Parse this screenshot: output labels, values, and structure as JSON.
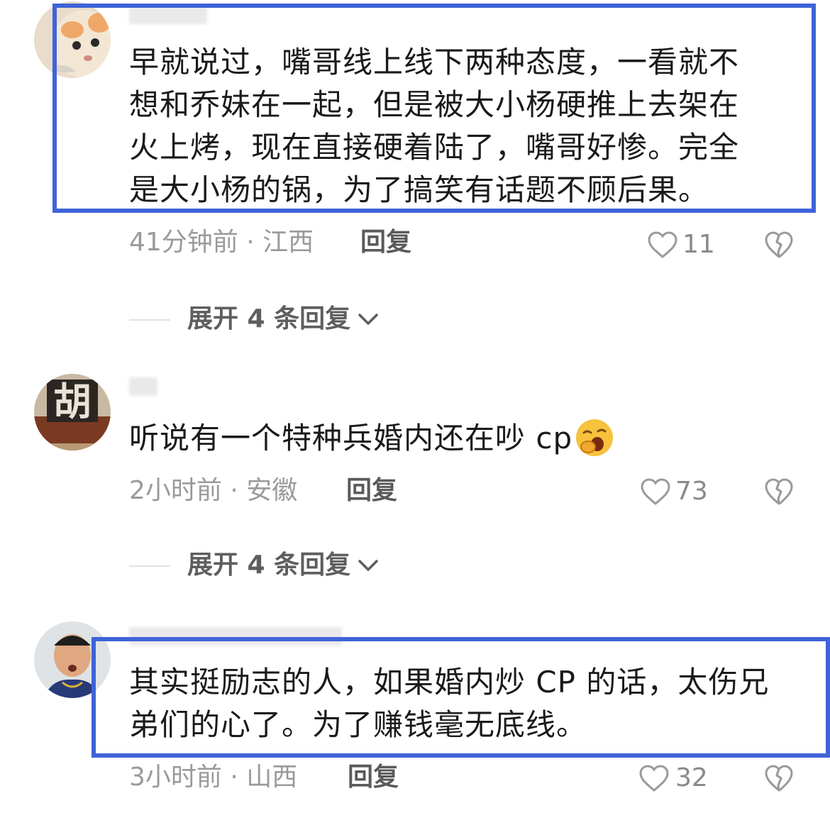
{
  "comments": [
    {
      "avatar": "cat-avatar",
      "lines": [
        "早就说过，嘴哥线上线下两种态度，一看就不",
        "想和乔妹在一起，但是被大小杨硬推上去架在",
        "火上烤，现在直接硬着陆了，嘴哥好惨。完全",
        "是大小杨的锅，为了搞笑有话题不顾后果。"
      ],
      "meta": "41分钟前 · 江西",
      "reply_label": "回复",
      "likes": "11",
      "expand_label": "展开 4 条回复"
    },
    {
      "avatar": "poster-avatar",
      "lines": [
        "听说有一个特种兵婚内还在吵 cp"
      ],
      "emoji": "yawning-face-emoji",
      "meta": "2小时前 · 安徽",
      "reply_label": "回复",
      "likes": "73",
      "expand_label": "展开 4 条回复"
    },
    {
      "avatar": "man-avatar",
      "lines": [
        "其实挺励志的人，如果婚内炒 CP 的话，太伤兄",
        "弟们的心了。为了赚钱毫无底线。"
      ],
      "meta": "3小时前 · 山西",
      "reply_label": "回复",
      "likes": "32"
    }
  ],
  "colors": {
    "highlight": "#3f63d8",
    "text": "#1a1a1a",
    "meta": "#9a9a9a"
  },
  "icons": [
    "heart-outline-icon",
    "broken-heart-icon",
    "chevron-down-icon"
  ]
}
